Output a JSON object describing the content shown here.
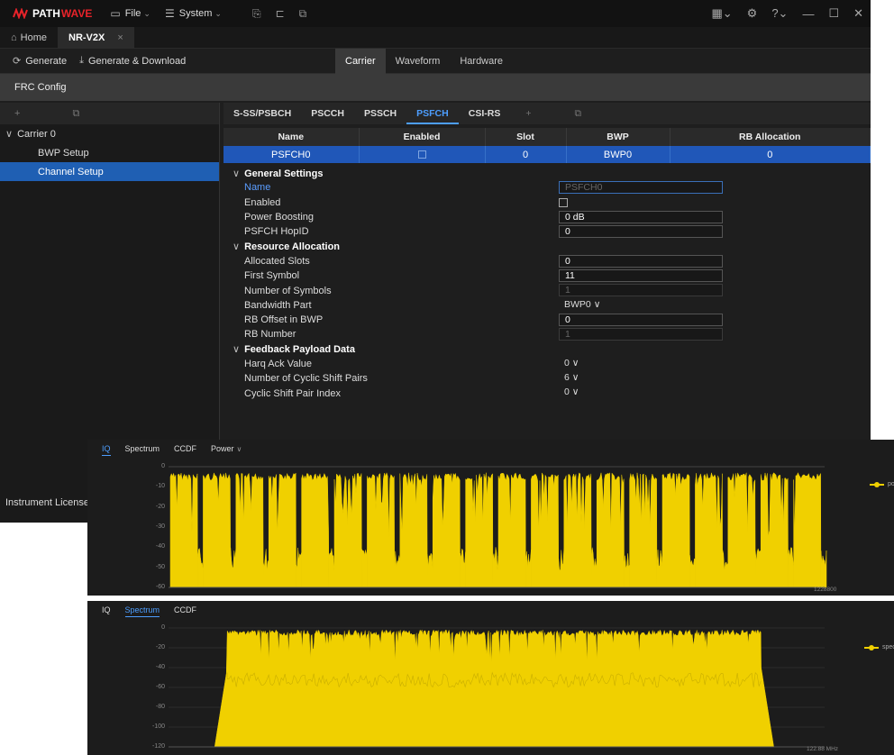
{
  "app": {
    "logo_path": "PATH",
    "logo_wave": "WAVE",
    "menu": [
      {
        "label": "File",
        "icon": "folder-icon"
      },
      {
        "label": "System",
        "icon": "system-icon"
      }
    ]
  },
  "tabs": {
    "home": "Home",
    "active": "NR-V2X",
    "close_glyph": "×"
  },
  "toolbar": {
    "generate": "Generate",
    "generate_download": "Generate & Download",
    "view_tabs": [
      "Carrier",
      "Waveform",
      "Hardware"
    ],
    "active_view": "Carrier"
  },
  "frc": {
    "label": "FRC Config"
  },
  "tree": {
    "carrier": "Carrier 0",
    "items": [
      "BWP Setup",
      "Channel Setup"
    ],
    "selected": "Channel Setup",
    "license": "Instrument License"
  },
  "channel_tabs": [
    "S-SS/PSBCH",
    "PSCCH",
    "PSSCH",
    "PSFCH",
    "CSI-RS"
  ],
  "active_channel_tab": "PSFCH",
  "grid": {
    "headers": [
      "Name",
      "Enabled",
      "Slot",
      "BWP",
      "RB Allocation"
    ],
    "row": {
      "name": "PSFCH0",
      "slot": "0",
      "bwp": "BWP0",
      "rb_allocation": "0"
    }
  },
  "sections": {
    "general": "General Settings",
    "resource": "Resource Allocation",
    "feedback": "Feedback Payload Data"
  },
  "props": {
    "name_label": "Name",
    "name_value": "PSFCH0",
    "enabled_label": "Enabled",
    "power_label": "Power Boosting",
    "power_value": "0 dB",
    "hopid_label": "PSFCH HopID",
    "hopid_value": "0",
    "alloc_slots_label": "Allocated Slots",
    "alloc_slots_value": "0",
    "first_symbol_label": "First Symbol",
    "first_symbol_value": "11",
    "num_symbols_label": "Number of Symbols",
    "num_symbols_value": "1",
    "bwp_label": "Bandwidth Part",
    "bwp_value": "BWP0",
    "rb_offset_label": "RB Offset in BWP",
    "rb_offset_value": "0",
    "rb_number_label": "RB Number",
    "rb_number_value": "1",
    "harq_label": "Harq Ack Value",
    "harq_value": "0",
    "cyclic_pairs_label": "Number of Cyclic Shift Pairs",
    "cyclic_pairs_value": "6",
    "cyclic_index_label": "Cyclic Shift Pair Index",
    "cyclic_index_value": "0"
  },
  "panel1": {
    "tabs": [
      "IQ",
      "Spectrum",
      "CCDF",
      "Power"
    ],
    "active": "IQ",
    "yticks": [
      "0",
      "-10",
      "-20",
      "-30",
      "-40",
      "-50",
      "-60"
    ],
    "x_max": "1228800",
    "legend": "power"
  },
  "panel2": {
    "tabs": [
      "IQ",
      "Spectrum",
      "CCDF"
    ],
    "active": "Spectrum",
    "yticks": [
      "0",
      "-20",
      "-40",
      "-60",
      "-80",
      "-100",
      "-120"
    ],
    "x_max": "122.88 MHz",
    "legend": "spectrum"
  },
  "chart_data": [
    {
      "type": "area",
      "title": "",
      "ylim": [
        -60,
        0
      ],
      "xlim": [
        0,
        1228800
      ],
      "bursts": 20,
      "burst_top": -3,
      "burst_floor": -40,
      "series": [
        {
          "name": "power",
          "color": "#f0d000"
        }
      ]
    },
    {
      "type": "area",
      "title": "",
      "ylim": [
        -120,
        0
      ],
      "xlim": [
        0,
        122.88
      ],
      "x_unit": "MHz",
      "band_start": 11,
      "band_end": 111,
      "band_top": -2,
      "band_floor": -45,
      "series": [
        {
          "name": "spectrum",
          "color": "#f0d000"
        }
      ]
    }
  ],
  "colors": {
    "accent": "#4d9eff",
    "selection": "#2057b8",
    "trace": "#f0d000",
    "brand": "#e8232a"
  }
}
